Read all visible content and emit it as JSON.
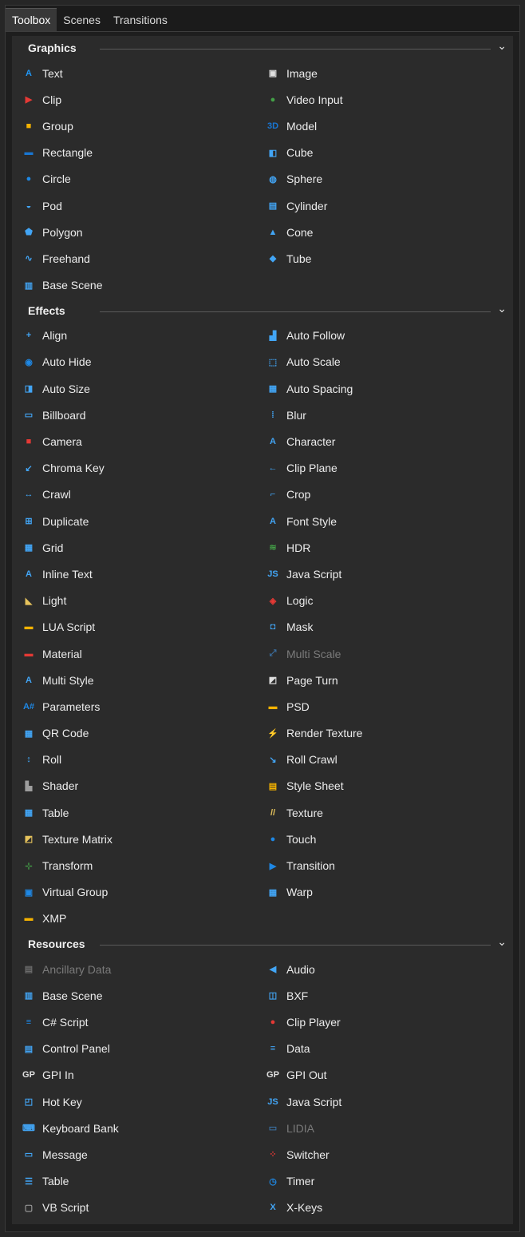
{
  "tabs": [
    "Toolbox",
    "Scenes",
    "Transitions"
  ],
  "sections": [
    {
      "title": "Graphics",
      "items": [
        {
          "label": "Text",
          "icon": "text-icon",
          "glyph": "A",
          "color": "#2196f3"
        },
        {
          "label": "Image",
          "icon": "image-icon",
          "glyph": "▣",
          "color": "#e0e0e0"
        },
        {
          "label": "Clip",
          "icon": "clip-icon",
          "glyph": "▶",
          "color": "#e53935"
        },
        {
          "label": "Video Input",
          "icon": "video-input-icon",
          "glyph": "●",
          "color": "#43a047"
        },
        {
          "label": "Group",
          "icon": "folder-icon",
          "glyph": "■",
          "color": "#f6b300"
        },
        {
          "label": "Model",
          "icon": "model-3d-icon",
          "glyph": "3D",
          "color": "#1976d2"
        },
        {
          "label": "Rectangle",
          "icon": "rectangle-icon",
          "glyph": "▬",
          "color": "#1976d2"
        },
        {
          "label": "Cube",
          "icon": "cube-icon",
          "glyph": "◧",
          "color": "#42a5f5"
        },
        {
          "label": "Circle",
          "icon": "circle-icon",
          "glyph": "●",
          "color": "#1e88e5"
        },
        {
          "label": "Sphere",
          "icon": "sphere-icon",
          "glyph": "◍",
          "color": "#42a5f5"
        },
        {
          "label": "Pod",
          "icon": "pod-icon",
          "glyph": "◒",
          "color": "#42a5f5"
        },
        {
          "label": "Cylinder",
          "icon": "cylinder-icon",
          "glyph": "▤",
          "color": "#42a5f5"
        },
        {
          "label": "Polygon",
          "icon": "polygon-icon",
          "glyph": "⬟",
          "color": "#42a5f5"
        },
        {
          "label": "Cone",
          "icon": "cone-icon",
          "glyph": "▲",
          "color": "#42a5f5"
        },
        {
          "label": "Freehand",
          "icon": "freehand-icon",
          "glyph": "∿",
          "color": "#42a5f5"
        },
        {
          "label": "Tube",
          "icon": "tube-icon",
          "glyph": "◆",
          "color": "#42a5f5"
        },
        {
          "label": "Base Scene",
          "icon": "base-scene-icon",
          "glyph": "▥",
          "color": "#42a5f5"
        }
      ]
    },
    {
      "title": "Effects",
      "items": [
        {
          "label": "Align",
          "icon": "align-icon",
          "glyph": "+",
          "color": "#42a5f5"
        },
        {
          "label": "Auto Follow",
          "icon": "auto-follow-icon",
          "glyph": "▟",
          "color": "#42a5f5"
        },
        {
          "label": "Auto Hide",
          "icon": "auto-hide-icon",
          "glyph": "◉",
          "color": "#1e88e5"
        },
        {
          "label": "Auto Scale",
          "icon": "auto-scale-icon",
          "glyph": "⬚",
          "color": "#42a5f5"
        },
        {
          "label": "Auto Size",
          "icon": "auto-size-icon",
          "glyph": "◨",
          "color": "#42a5f5"
        },
        {
          "label": "Auto Spacing",
          "icon": "auto-spacing-icon",
          "glyph": "▦",
          "color": "#42a5f5"
        },
        {
          "label": "Billboard",
          "icon": "billboard-icon",
          "glyph": "▭",
          "color": "#42a5f5"
        },
        {
          "label": "Blur",
          "icon": "blur-icon",
          "glyph": "⁞",
          "color": "#42a5f5"
        },
        {
          "label": "Camera",
          "icon": "camera-icon",
          "glyph": "■",
          "color": "#e53935"
        },
        {
          "label": "Character",
          "icon": "character-icon",
          "glyph": "A",
          "color": "#42a5f5"
        },
        {
          "label": "Chroma Key",
          "icon": "chroma-key-icon",
          "glyph": "↙",
          "color": "#42a5f5"
        },
        {
          "label": "Clip Plane",
          "icon": "clip-plane-icon",
          "glyph": "←",
          "color": "#42a5f5"
        },
        {
          "label": "Crawl",
          "icon": "crawl-icon",
          "glyph": "↔",
          "color": "#42a5f5"
        },
        {
          "label": "Crop",
          "icon": "crop-icon",
          "glyph": "⌐",
          "color": "#42a5f5"
        },
        {
          "label": "Duplicate",
          "icon": "duplicate-icon",
          "glyph": "⊞",
          "color": "#42a5f5"
        },
        {
          "label": "Font Style",
          "icon": "font-style-icon",
          "glyph": "A",
          "color": "#42a5f5"
        },
        {
          "label": "Grid",
          "icon": "grid-icon",
          "glyph": "▦",
          "color": "#42a5f5"
        },
        {
          "label": "HDR",
          "icon": "hdr-icon",
          "glyph": "≋",
          "color": "#43a047"
        },
        {
          "label": "Inline Text",
          "icon": "inline-text-icon",
          "glyph": "A",
          "color": "#42a5f5"
        },
        {
          "label": "Java Script",
          "icon": "java-script-icon",
          "glyph": "JS",
          "color": "#42a5f5"
        },
        {
          "label": "Light",
          "icon": "light-icon",
          "glyph": "◣",
          "color": "#e6c35c"
        },
        {
          "label": "Logic",
          "icon": "logic-icon",
          "glyph": "◈",
          "color": "#e53935"
        },
        {
          "label": "LUA Script",
          "icon": "lua-script-icon",
          "glyph": "▬",
          "color": "#f6b300"
        },
        {
          "label": "Mask",
          "icon": "mask-icon",
          "glyph": "◘",
          "color": "#42a5f5"
        },
        {
          "label": "Material",
          "icon": "material-icon",
          "glyph": "▬",
          "color": "#e53935"
        },
        {
          "label": "Multi Scale",
          "icon": "multi-scale-icon",
          "glyph": "⤢",
          "color": "#3b6fa0",
          "disabled": true
        },
        {
          "label": "Multi Style",
          "icon": "multi-style-icon",
          "glyph": "A",
          "color": "#42a5f5"
        },
        {
          "label": "Page Turn",
          "icon": "page-turn-icon",
          "glyph": "◩",
          "color": "#e0e0e0"
        },
        {
          "label": "Parameters",
          "icon": "parameters-icon",
          "glyph": "A#",
          "color": "#1e88e5"
        },
        {
          "label": "PSD",
          "icon": "psd-icon",
          "glyph": "▬",
          "color": "#f6b300"
        },
        {
          "label": "QR Code",
          "icon": "qr-code-icon",
          "glyph": "▦",
          "color": "#42a5f5"
        },
        {
          "label": "Render Texture",
          "icon": "render-texture-icon",
          "glyph": "⚡",
          "color": "#e6c35c"
        },
        {
          "label": "Roll",
          "icon": "roll-icon",
          "glyph": "↕",
          "color": "#42a5f5"
        },
        {
          "label": "Roll Crawl",
          "icon": "roll-crawl-icon",
          "glyph": "↘",
          "color": "#42a5f5"
        },
        {
          "label": "Shader",
          "icon": "shader-icon",
          "glyph": "▙",
          "color": "#9e9e9e"
        },
        {
          "label": "Style Sheet",
          "icon": "style-sheet-icon",
          "glyph": "▤",
          "color": "#f6b300"
        },
        {
          "label": "Table",
          "icon": "table-icon",
          "glyph": "▦",
          "color": "#42a5f5"
        },
        {
          "label": "Texture",
          "icon": "texture-icon",
          "glyph": "//",
          "color": "#e6c35c"
        },
        {
          "label": "Texture Matrix",
          "icon": "texture-matrix-icon",
          "glyph": "◩",
          "color": "#e6c35c"
        },
        {
          "label": "Touch",
          "icon": "touch-icon",
          "glyph": "●",
          "color": "#1e88e5"
        },
        {
          "label": "Transform",
          "icon": "transform-icon",
          "glyph": "⊹",
          "color": "#43a047"
        },
        {
          "label": "Transition",
          "icon": "transition-icon",
          "glyph": "▶",
          "color": "#1e88e5"
        },
        {
          "label": "Virtual Group",
          "icon": "virtual-group-icon",
          "glyph": "▣",
          "color": "#1e88e5"
        },
        {
          "label": "Warp",
          "icon": "warp-icon",
          "glyph": "▦",
          "color": "#42a5f5"
        },
        {
          "label": "XMP",
          "icon": "xmp-icon",
          "glyph": "▬",
          "color": "#f6b300"
        }
      ]
    },
    {
      "title": "Resources",
      "items": [
        {
          "label": "Ancillary Data",
          "icon": "ancillary-data-icon",
          "glyph": "▤",
          "color": "#6b6b6b",
          "disabled": true
        },
        {
          "label": "Audio",
          "icon": "audio-icon",
          "glyph": "◀",
          "color": "#42a5f5"
        },
        {
          "label": "Base Scene",
          "icon": "base-scene-icon",
          "glyph": "▥",
          "color": "#42a5f5"
        },
        {
          "label": "BXF",
          "icon": "bxf-icon",
          "glyph": "◫",
          "color": "#42a5f5"
        },
        {
          "label": "C# Script",
          "icon": "csharp-script-icon",
          "glyph": "≡",
          "color": "#1e88e5"
        },
        {
          "label": "Clip Player",
          "icon": "clip-player-icon",
          "glyph": "●",
          "color": "#e53935"
        },
        {
          "label": "Control Panel",
          "icon": "control-panel-icon",
          "glyph": "▤",
          "color": "#42a5f5"
        },
        {
          "label": "Data",
          "icon": "data-icon",
          "glyph": "≡",
          "color": "#42a5f5"
        },
        {
          "label": "GPI In",
          "icon": "gpi-in-icon",
          "glyph": "GP",
          "color": "#e0e0e0"
        },
        {
          "label": "GPI Out",
          "icon": "gpi-out-icon",
          "glyph": "GP",
          "color": "#e0e0e0"
        },
        {
          "label": "Hot Key",
          "icon": "hot-key-icon",
          "glyph": "◰",
          "color": "#42a5f5"
        },
        {
          "label": "Java Script",
          "icon": "java-script-icon",
          "glyph": "JS",
          "color": "#42a5f5"
        },
        {
          "label": "Keyboard Bank",
          "icon": "keyboard-bank-icon",
          "glyph": "⌨",
          "color": "#42a5f5"
        },
        {
          "label": "LIDIA",
          "icon": "lidia-icon",
          "glyph": "▭",
          "color": "#3b6fa0",
          "disabled": true
        },
        {
          "label": "Message",
          "icon": "message-icon",
          "glyph": "▭",
          "color": "#42a5f5"
        },
        {
          "label": "Switcher",
          "icon": "switcher-icon",
          "glyph": "⁘",
          "color": "#e53935"
        },
        {
          "label": "Table",
          "icon": "table-list-icon",
          "glyph": "☰",
          "color": "#42a5f5"
        },
        {
          "label": "Timer",
          "icon": "timer-icon",
          "glyph": "◷",
          "color": "#1e88e5"
        },
        {
          "label": "VB Script",
          "icon": "vb-script-icon",
          "glyph": "▢",
          "color": "#9e9e9e"
        },
        {
          "label": "X-Keys",
          "icon": "x-keys-icon",
          "glyph": "X",
          "color": "#42a5f5"
        }
      ]
    }
  ]
}
